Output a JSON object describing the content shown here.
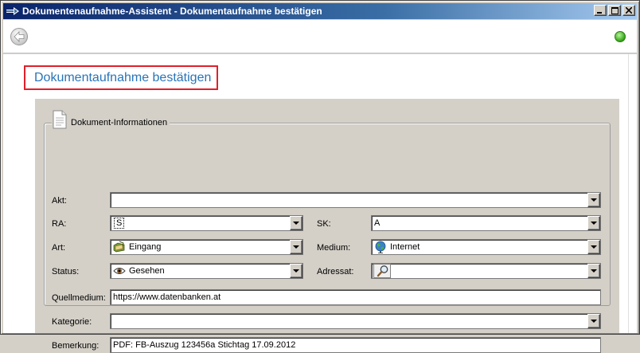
{
  "window": {
    "title": "Dokumentenaufnahme-Assistent - Dokumentaufnahme bestätigen",
    "buttons": {
      "minimize": "_",
      "maximize": "□",
      "close": "×"
    }
  },
  "page": {
    "heading": "Dokumentaufnahme bestätigen"
  },
  "group": {
    "label": "Dokument-Informationen",
    "fields": {
      "akt": {
        "label": "Akt:",
        "value": ""
      },
      "ra": {
        "label": "RA:",
        "value": "S"
      },
      "sk": {
        "label": "SK:",
        "value": "A"
      },
      "art": {
        "label": "Art:",
        "value": "Eingang",
        "icon": "folder-icon"
      },
      "medium": {
        "label": "Medium:",
        "value": "Internet",
        "icon": "globe-icon"
      },
      "status": {
        "label": "Status:",
        "value": "Gesehen",
        "icon": "eye-icon"
      },
      "adressat": {
        "label": "Adressat:",
        "value": "",
        "icon": "magnifier-icon"
      },
      "quellmedium": {
        "label": "Quellmedium:",
        "value": "https://www.datenbanken.at"
      },
      "kategorie": {
        "label": "Kategorie:",
        "value": ""
      },
      "bemerkung": {
        "label": "Bemerkung:",
        "value": "PDF: FB-Auszug 123456a Stichtag 17.09.2012"
      }
    }
  },
  "colors": {
    "heading": "#2874b8",
    "heading_border": "#e0202a",
    "status_light": "#3aa81e"
  }
}
